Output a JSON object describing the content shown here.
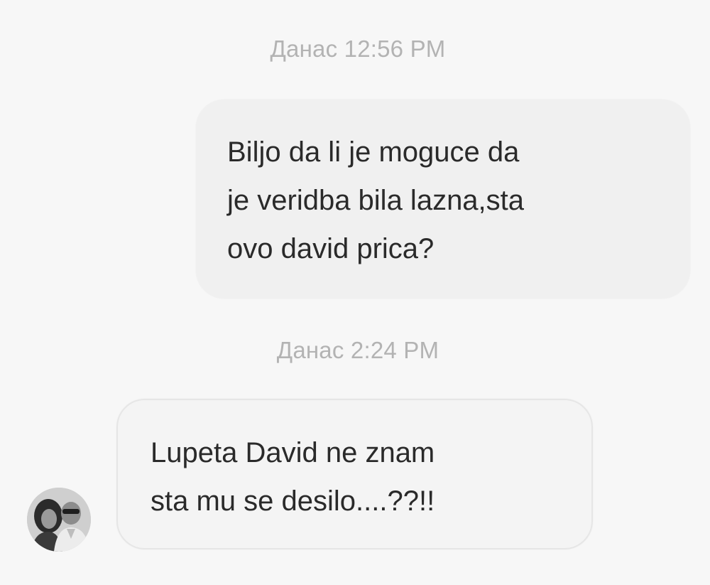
{
  "conversation": {
    "timestamps": [
      "Данас 12:56 PM",
      "Данас 2:24 PM"
    ],
    "messages": [
      {
        "direction": "sent",
        "lines": [
          "Biljo da li je moguce da",
          "je veridba bila lazna,sta",
          "ovo david prica?"
        ]
      },
      {
        "direction": "received",
        "lines": [
          "Lupeta David ne znam",
          "sta mu se desilo....??!!"
        ]
      }
    ]
  },
  "colors": {
    "background": "#f7f7f7",
    "bubble": "#f0f0f0",
    "timestamp": "#b3b3b3",
    "text": "#2a2a2a"
  },
  "icons": {
    "avatar": "contact-avatar-photo"
  }
}
